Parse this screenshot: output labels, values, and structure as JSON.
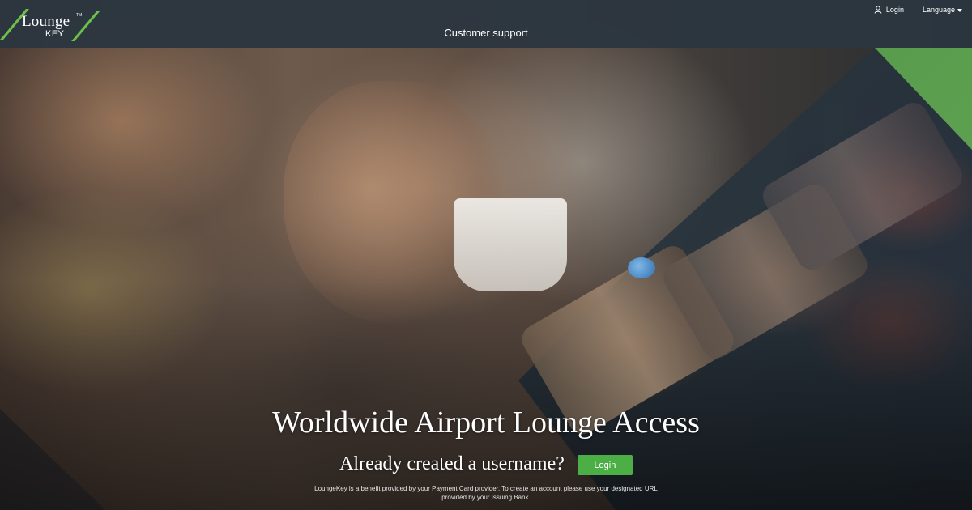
{
  "brand": {
    "logo_word": "Lounge",
    "logo_sub": "KEY",
    "logo_tm": "TM",
    "accent_color": "#6cc04a"
  },
  "header": {
    "nav_center": "Customer support",
    "login_label": "Login",
    "language_label": "Language",
    "user_icon": "user-icon",
    "language_icon": "chevron-down-icon"
  },
  "hero": {
    "headline": "Worldwide Airport Lounge Access",
    "cta_text": "Already created a username?",
    "login_button": "Login",
    "button_color": "#4caf45",
    "disclaimer": "LoungeKey is a benefit provided by your Payment Card provider. To create an account please use your designated URL provided by your Issuing Bank."
  }
}
